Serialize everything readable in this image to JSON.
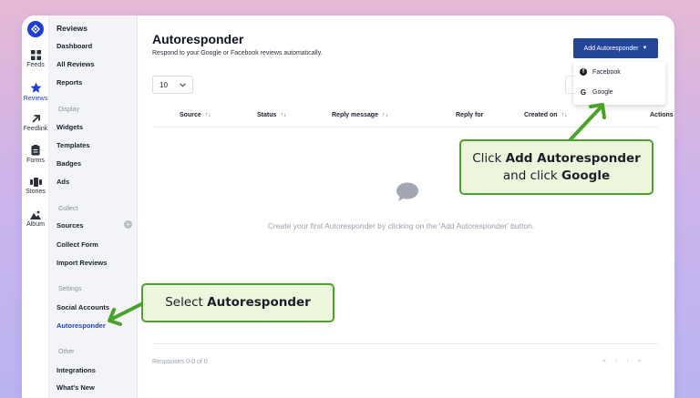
{
  "rail": {
    "items": [
      {
        "label": "Feeds",
        "icon": "grid-icon"
      },
      {
        "label": "Reviews",
        "icon": "star-icon",
        "active": true
      },
      {
        "label": "Feedlink",
        "icon": "arrow-up-right-icon"
      },
      {
        "label": "Forms",
        "icon": "form-icon"
      },
      {
        "label": "Stories",
        "icon": "stories-icon"
      },
      {
        "label": "Album",
        "icon": "image-icon"
      }
    ]
  },
  "sidebar": {
    "title": "Reviews",
    "items_top": [
      "Dashboard",
      "All Reviews",
      "Reports"
    ],
    "section_display": "Display",
    "items_display": [
      "Widgets",
      "Templates",
      "Badges",
      "Ads"
    ],
    "section_collect": "Collect",
    "items_collect": [
      "Sources",
      "Collect Form",
      "Import Reviews"
    ],
    "section_settings": "Settings",
    "items_settings": [
      "Social Accounts",
      "Autoresponder"
    ],
    "section_other": "Other",
    "items_other": [
      "Integrations",
      "What's New"
    ]
  },
  "main": {
    "title": "Autoresponder",
    "subtitle": "Respond to your Google or Facebook reviews automatically.",
    "add_button": "Add Autoresponder",
    "dropdown": [
      "Facebook",
      "Google"
    ],
    "per_page": "10",
    "columns": [
      "Source",
      "Status",
      "Reply message",
      "Reply for",
      "Created on",
      "Actions"
    ],
    "empty_text": "Create your first Autoresponder by clicking on the 'Add Autoresponder' button.",
    "footer": "Responses 0-0 of 0"
  },
  "callouts": {
    "top": {
      "pre": "Click ",
      "bold1": "Add Autoresponder",
      "mid": "and click ",
      "bold2": "Google"
    },
    "bottom": {
      "pre": "Select ",
      "bold": "Autoresponder"
    }
  },
  "colors": {
    "accent": "#1d3fd6",
    "button": "#23469a",
    "callout_border": "#49a32a",
    "callout_bg": "#ecf6dc"
  }
}
